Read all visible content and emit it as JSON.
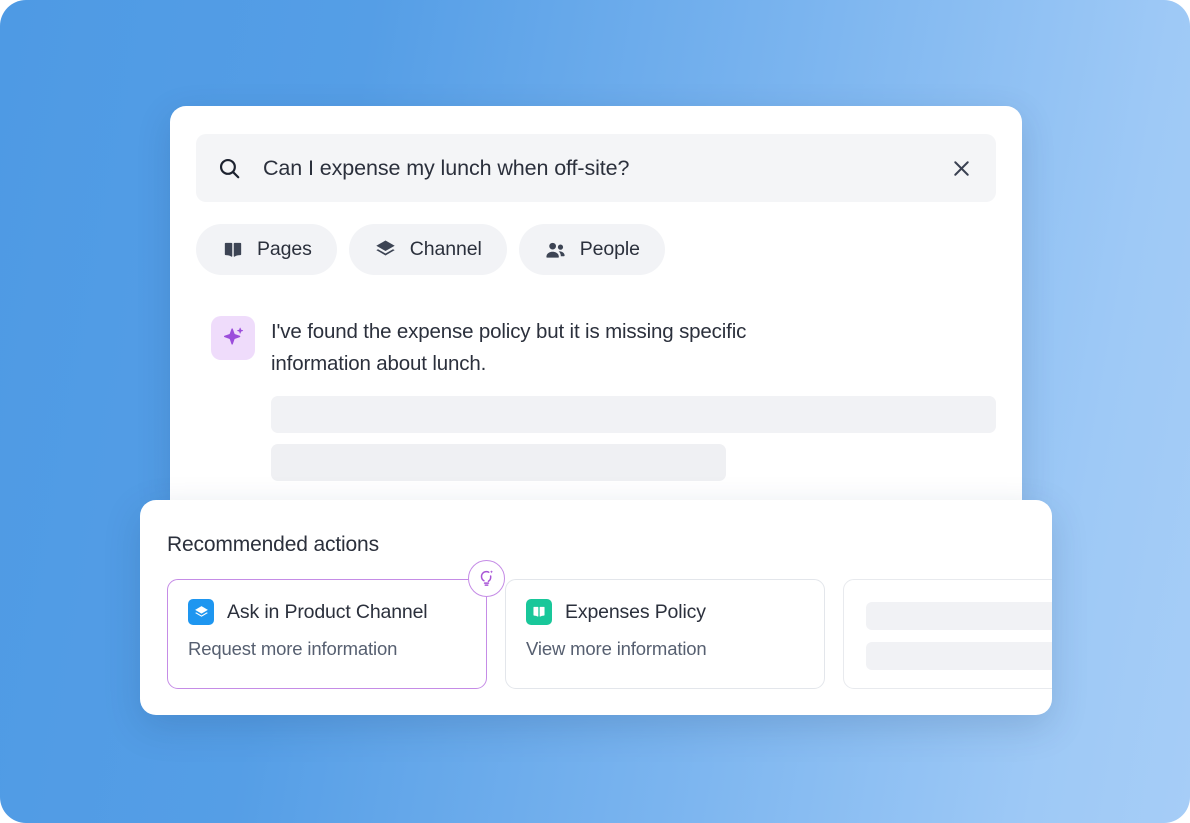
{
  "background": {
    "gradient_from": "#4e9ae4",
    "gradient_to": "#a6cdf7"
  },
  "search": {
    "icon": "search-icon",
    "value": "Can I expense my lunch when off-site?",
    "placeholder": "Search",
    "clear_icon": "close-icon"
  },
  "filters": [
    {
      "label": "Pages",
      "icon": "book-icon"
    },
    {
      "label": "Channel",
      "icon": "layers-icon"
    },
    {
      "label": "People",
      "icon": "people-icon"
    }
  ],
  "answer": {
    "icon": "sparkle-icon",
    "accent": "#9b4ddb",
    "badge_bg": "#efdcfb",
    "text": "I've found the expense policy but it is missing specific information about lunch."
  },
  "recommended": {
    "title": "Recommended actions",
    "cards": [
      {
        "title": "Ask in Product Channel",
        "subtitle": "Request more information",
        "icon": "layers-icon",
        "icon_color": "#1e96f0",
        "selected": true,
        "badge_icon": "lightbulb-sparkle-icon",
        "badge_color": "#c58ce6"
      },
      {
        "title": "Expenses Policy",
        "subtitle": "View more information",
        "icon": "book-icon",
        "icon_color": "#19c79a",
        "selected": false
      },
      {
        "title": "",
        "subtitle": "",
        "icon": "skeleton-placeholder",
        "selected": false
      }
    ]
  }
}
